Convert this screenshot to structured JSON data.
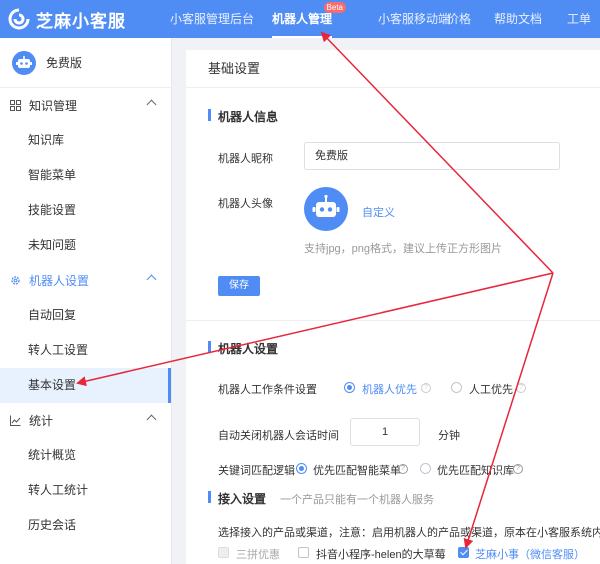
{
  "header": {
    "logo_text": "芝麻小客服",
    "nav": [
      {
        "label": "小客服管理后台",
        "active": false
      },
      {
        "label": "机器人管理",
        "active": true,
        "badge": "Beta"
      },
      {
        "label": "小客服移动端",
        "active": false
      },
      {
        "label": "价格",
        "active": false
      },
      {
        "label": "帮助文档",
        "active": false
      },
      {
        "label": "工单",
        "active": false
      }
    ]
  },
  "sidebar": {
    "bot_name": "免费版",
    "groups": [
      {
        "label": "知识管理",
        "icon": "grid-icon",
        "items": [
          "知识库",
          "智能菜单",
          "技能设置",
          "未知问题"
        ]
      },
      {
        "label": "机器人设置",
        "icon": "gear-icon",
        "items": [
          "自动回复",
          "转人工设置",
          "基本设置"
        ]
      },
      {
        "label": "统计",
        "icon": "chart-icon",
        "items": [
          "统计概览",
          "转人工统计",
          "历史会话"
        ]
      }
    ]
  },
  "main": {
    "title": "基础设置",
    "robot_info": {
      "heading": "机器人信息",
      "nickname_label": "机器人昵称",
      "nickname_value": "免费版",
      "avatar_label": "机器人头像",
      "customize_link": "自定义",
      "avatar_hint": "支持jpg，png格式，建议上传正方形图片",
      "save_label": "保存"
    },
    "robot_settings": {
      "heading": "机器人设置",
      "work_condition_label": "机器人工作条件设置",
      "option_robot_first": "机器人优先",
      "option_human_first": "人工优先",
      "auto_close_label": "自动关闭机器人会话时间",
      "auto_close_value": "1",
      "auto_close_unit": "分钟",
      "keyword_logic_label": "关键词匹配逻辑",
      "option_menu_first": "优先匹配智能菜单",
      "option_kb_first": "优先匹配知识库"
    },
    "access": {
      "heading": "接入设置",
      "subheading": "一个产品只能有一个机器人服务",
      "note": "选择接入的产品或渠道，注意：启用机器人的产品或渠道，原本在小客服系统内设置的",
      "channels": [
        {
          "label": "三拼优惠",
          "state": "disabled"
        },
        {
          "label": "抖音小程序-helen的大草莓",
          "state": "unchecked"
        },
        {
          "label": "芝麻小事（微信客服）",
          "state": "checked"
        }
      ]
    }
  },
  "colors": {
    "primary": "#4f8df5",
    "arrow": "#e8263a",
    "active_bg": "#e8f2ff"
  }
}
